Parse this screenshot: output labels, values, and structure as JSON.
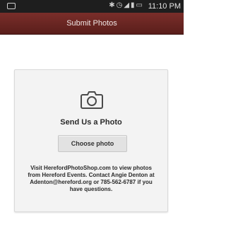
{
  "status_bar": {
    "icons": [
      "notification-icon",
      "bluetooth-icon",
      "alarm-icon",
      "wifi-icon",
      "signal-icon",
      "battery-icon"
    ],
    "time": "11:10 PM"
  },
  "header": {
    "title": "Submit Photos"
  },
  "upload_card": {
    "icon": "camera-icon",
    "title": "Send Us a Photo",
    "button_label": "Choose photo",
    "info_text": "Visit HerefordPhotoShop.com to view photos from Hereford Events. Contact Angie Denton at Adenton@hereford.org or 785-562-6787 if you have questions."
  },
  "colors": {
    "header_bg": "#6a2622",
    "status_bar_bg": "#1e1e1e",
    "card_bg": "#f3f3f3"
  }
}
